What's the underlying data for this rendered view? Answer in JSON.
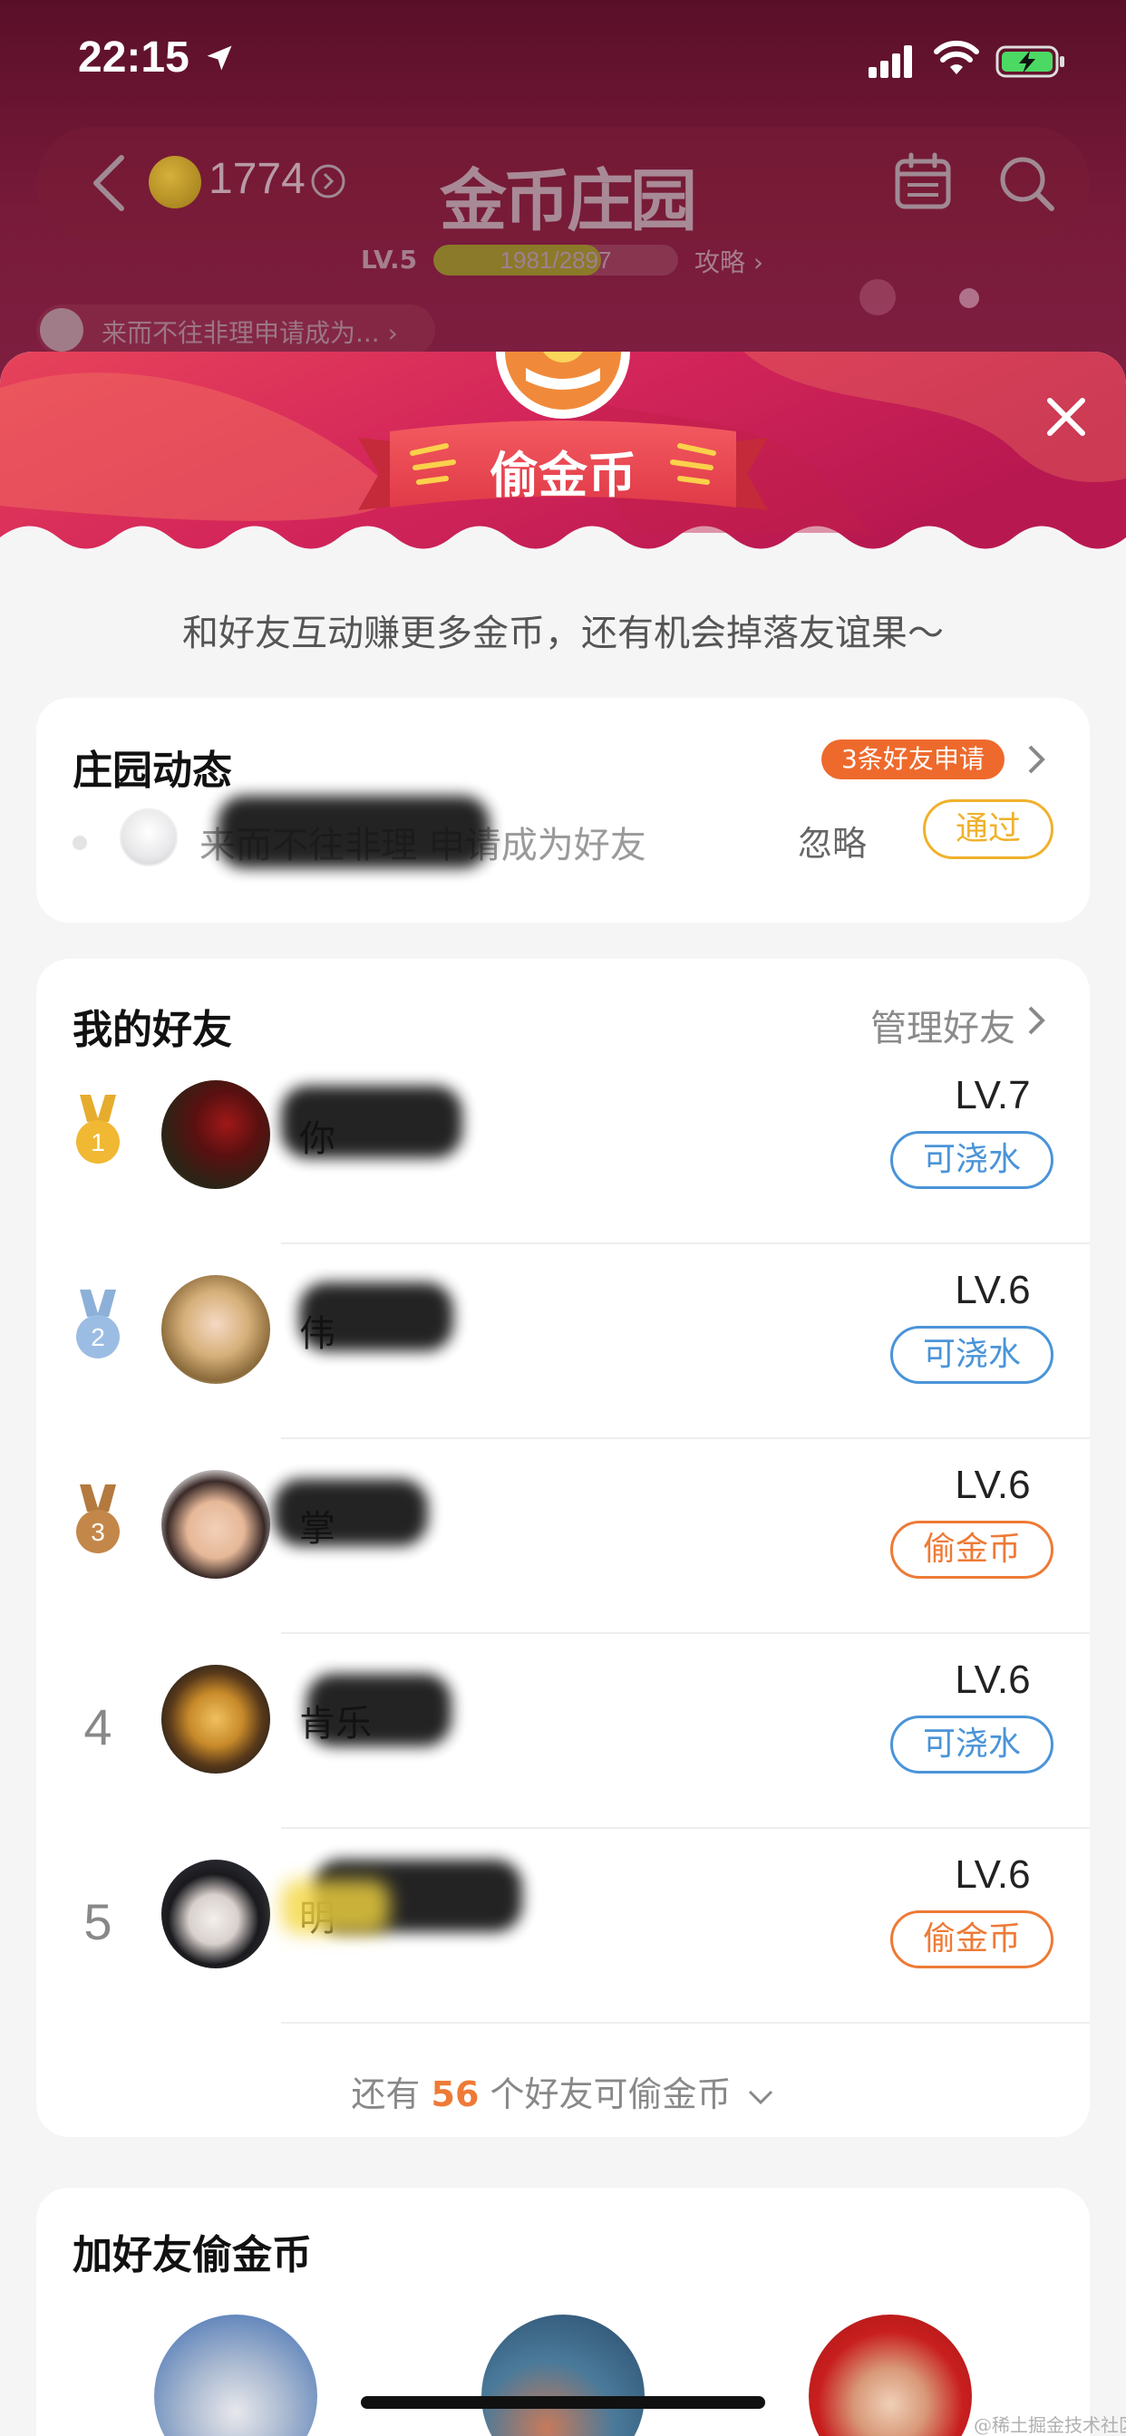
{
  "status_bar": {
    "time": "22:15"
  },
  "top_nav": {
    "coin_count": "1774",
    "app_title": "金币庄园",
    "level_label": "LV.5",
    "level_progress_text": "1981/2897",
    "level_progress": 0.684,
    "guide_link": "攻略 ›",
    "ticker_text": "来而不往非理申请成为... ›"
  },
  "sheet": {
    "title": "偷金币",
    "subtitle": "和好友互动赚更多金币，还有机会掉落友谊果～"
  },
  "activity": {
    "title": "庄园动态",
    "badge": "3条好友申请",
    "request_text": "来而不往非理 申请成为好友",
    "ignore_label": "忽略",
    "pass_label": "通过"
  },
  "friends": {
    "title": "我的好友",
    "manage_label": "管理好友",
    "rows": [
      {
        "rank": "1",
        "name": "你",
        "level": "LV.7",
        "action": "可浇水",
        "action_type": "water",
        "medal": "gold"
      },
      {
        "rank": "2",
        "name": "伟",
        "level": "LV.6",
        "action": "可浇水",
        "action_type": "water",
        "medal": "silver"
      },
      {
        "rank": "3",
        "name": "掌",
        "level": "LV.6",
        "action": "偷金币",
        "action_type": "steal",
        "medal": "bronze"
      },
      {
        "rank": "4",
        "name": "肯乐",
        "level": "LV.6",
        "action": "可浇水",
        "action_type": "water"
      },
      {
        "rank": "5",
        "name": "明",
        "level": "LV.6",
        "action": "偷金币",
        "action_type": "steal"
      }
    ],
    "more_prefix": "还有",
    "more_count": "56",
    "more_suffix": "个好友可偷金币"
  },
  "add_friends": {
    "title": "加好友偷金币"
  },
  "watermark": "@稀土掘金技术社区",
  "colors": {
    "accent_orange": "#ee7a36",
    "water_blue": "#4a94d8",
    "pass_yellow": "#f0b12c",
    "header_red": "#e83e54"
  }
}
